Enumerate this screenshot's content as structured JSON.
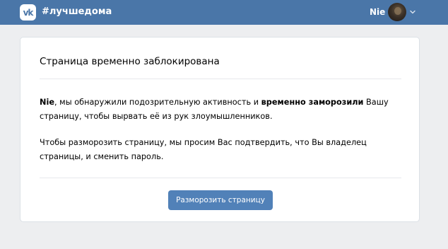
{
  "header": {
    "logo_text": "vk",
    "hashtag": "#лучшедома",
    "user_name": "Nie",
    "accent_color": "#4a76a8"
  },
  "card": {
    "title": "Страница временно заблокирована",
    "paragraph1": {
      "name": "Nie",
      "text_a": ", мы обнаружили подозрительную активность и ",
      "bold_phrase": "временно заморозили",
      "text_b": " Вашу страницу, чтобы вырвать её из рук злоумышленников."
    },
    "paragraph2": "Чтобы разморозить страницу, мы просим Вас подтвердить, что Вы владелец страницы, и сменить пароль.",
    "button_label": "Разморозить страницу",
    "button_color": "#5181b8"
  }
}
